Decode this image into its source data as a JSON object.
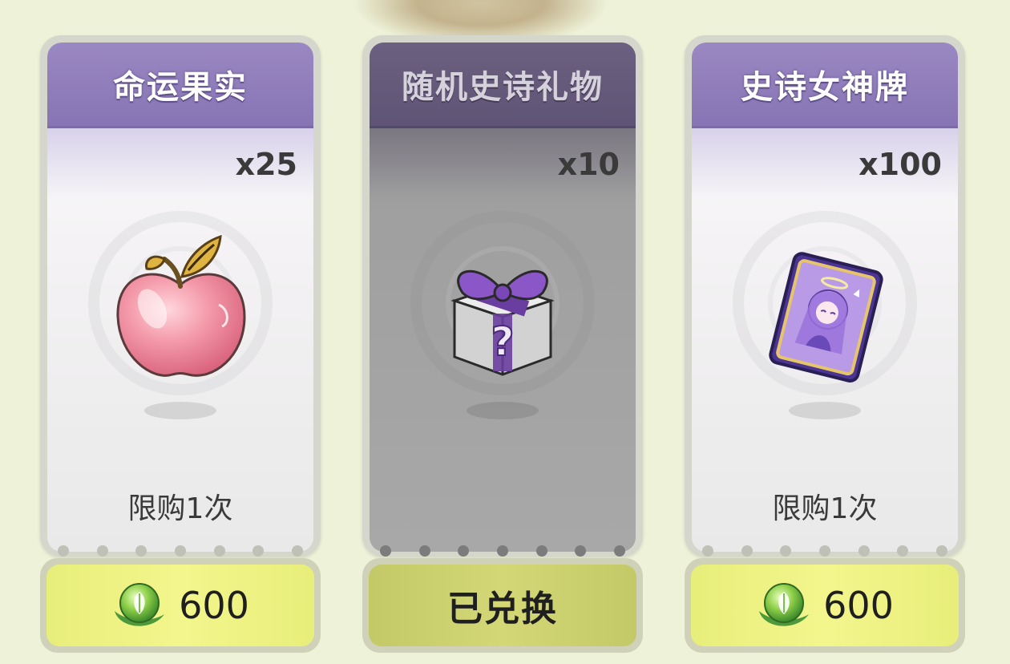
{
  "cards": [
    {
      "title": "命运果实",
      "quantity": "x25",
      "limit": "限购1次",
      "price": "600",
      "icon": "apple-icon",
      "redeemed": false
    },
    {
      "title": "随机史诗礼物",
      "quantity": "x10",
      "status": "已兑换",
      "icon": "mystery-gift-box-icon",
      "redeemed": true
    },
    {
      "title": "史诗女神牌",
      "quantity": "x100",
      "limit": "限购1次",
      "price": "600",
      "icon": "goddess-card-icon",
      "redeemed": false
    }
  ],
  "currency_icon": "leaf-orb-icon",
  "colors": {
    "header_purple": "#8774b4",
    "price_yellow": "#f3f68c",
    "background": "#eef2d9"
  }
}
